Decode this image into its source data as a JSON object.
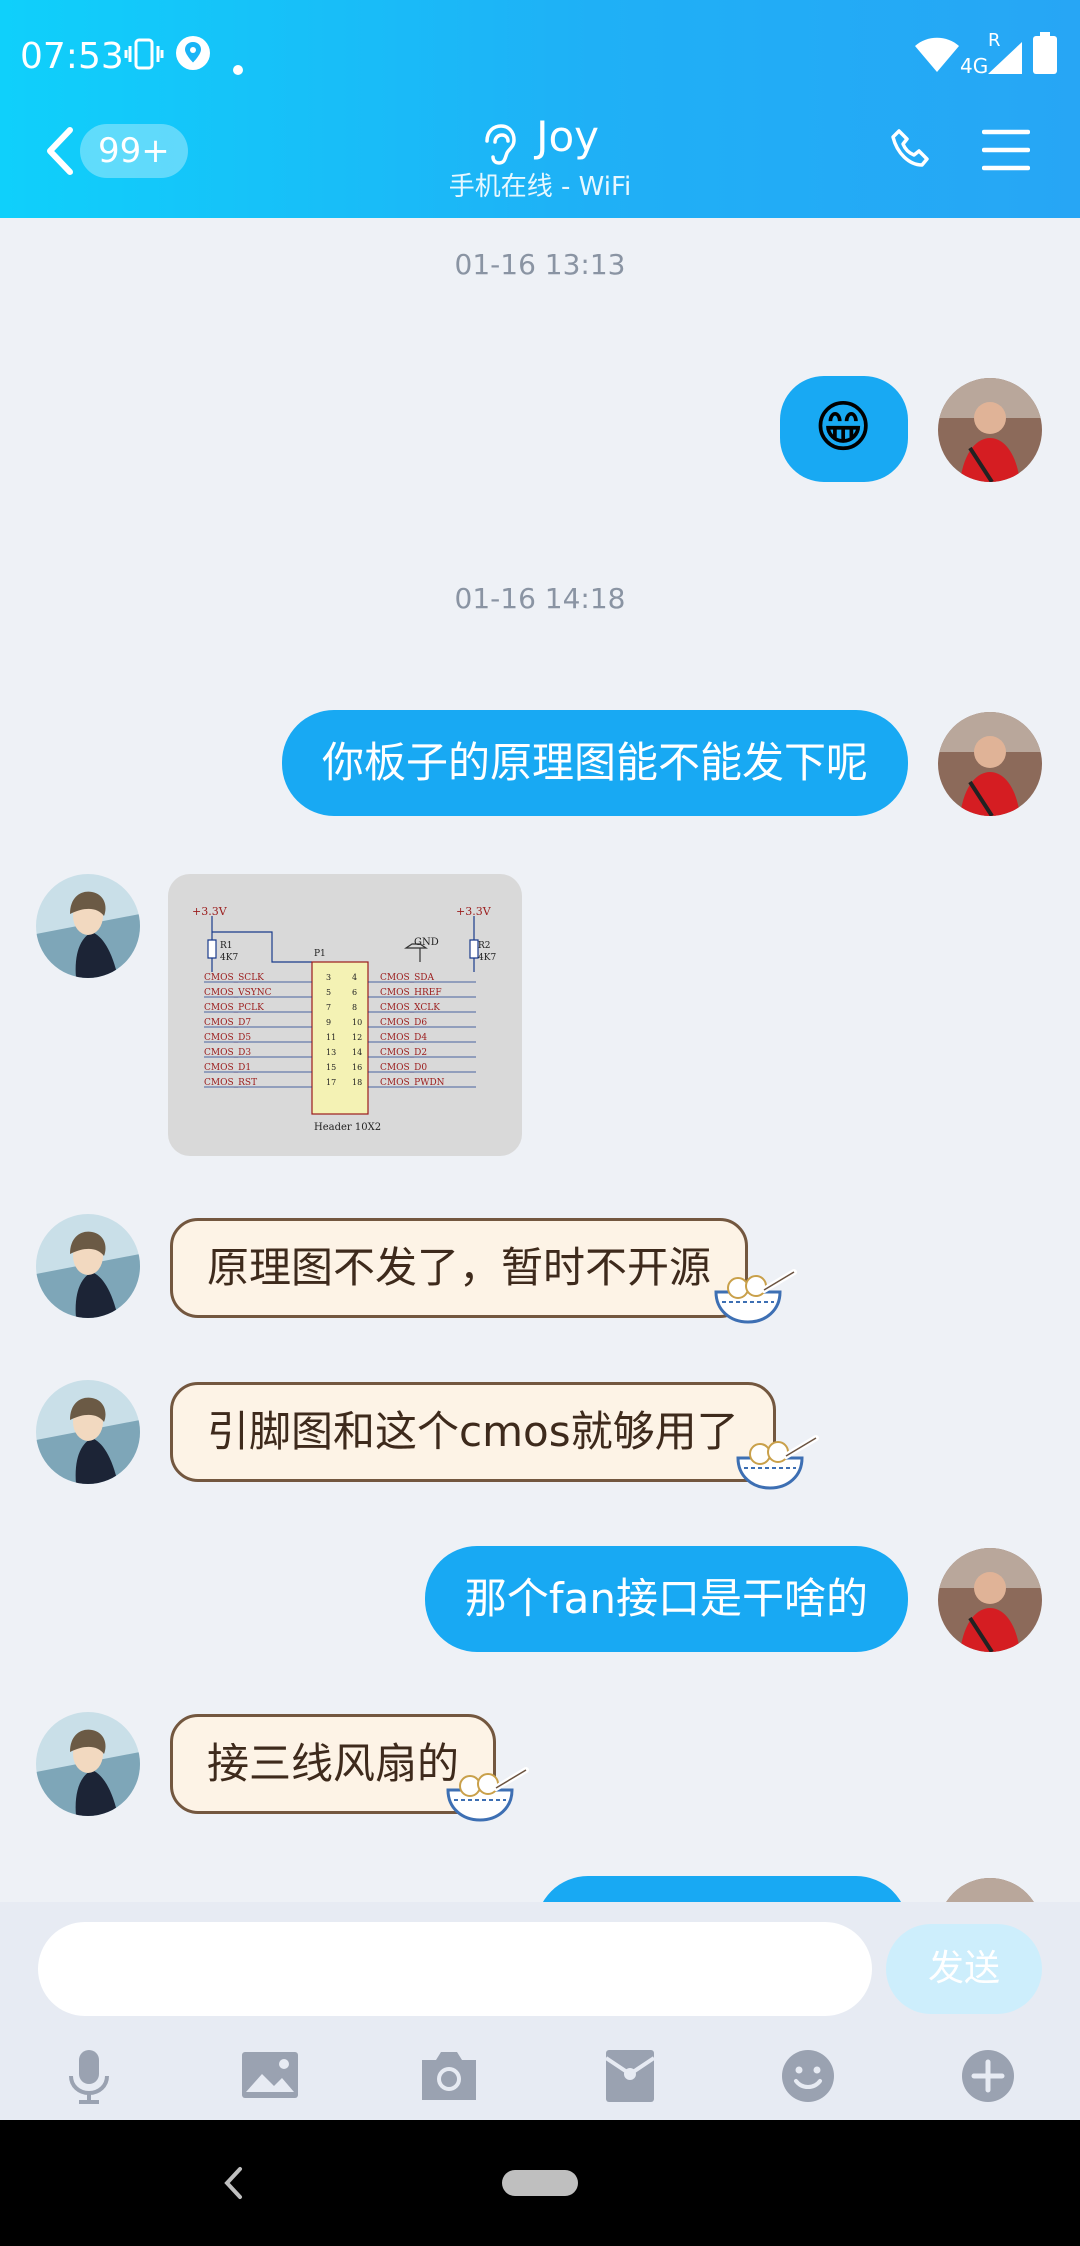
{
  "status_bar": {
    "time": "07:53",
    "network": "4G",
    "roaming": "R"
  },
  "header": {
    "unread_badge": "99+",
    "contact_name": "Joy",
    "contact_status": "手机在线 - WiFi"
  },
  "messages": {
    "ts1": "01-16 13:13",
    "emoji_reply": "😁",
    "ts2": "01-16 14:18",
    "m1": "你板子的原理图能不能发下呢",
    "m2": "原理图不发了，暂时不开源",
    "m3": "引脚图和这个cmos就够用了",
    "m4": "那个fan接口是干啥的",
    "m5": "接三线风扇的"
  },
  "schematic": {
    "left_power": "+3.3V",
    "right_power": "+3.3V",
    "gnd": "GND",
    "r1": "R1",
    "r1_val": "4K7",
    "r2": "R2",
    "r2_val": "4K7",
    "part": "P1",
    "footer": "Header 10X2",
    "left_pins": [
      "CMOS_SCLK",
      "CMOS_VSYNC",
      "CMOS_PCLK",
      "CMOS_D7",
      "CMOS_D5",
      "CMOS_D3",
      "CMOS_D1",
      "CMOS_RST"
    ],
    "right_pins": [
      "CMOS_SDA",
      "CMOS_HREF",
      "CMOS_XCLK",
      "CMOS_D6",
      "CMOS_D4",
      "CMOS_D2",
      "CMOS_D0",
      "CMOS_PWDN"
    ]
  },
  "input_bar": {
    "placeholder": "",
    "send_label": "发送"
  },
  "toolbar": [
    "mic-icon",
    "image-icon",
    "camera-icon",
    "red-packet-icon",
    "emoji-icon",
    "plus-icon"
  ],
  "colors": {
    "header_start": "#0fd0fb",
    "header_end": "#27a6f5",
    "bubble_out": "#18a9f3",
    "bubble_in": "#fdf3e6"
  }
}
